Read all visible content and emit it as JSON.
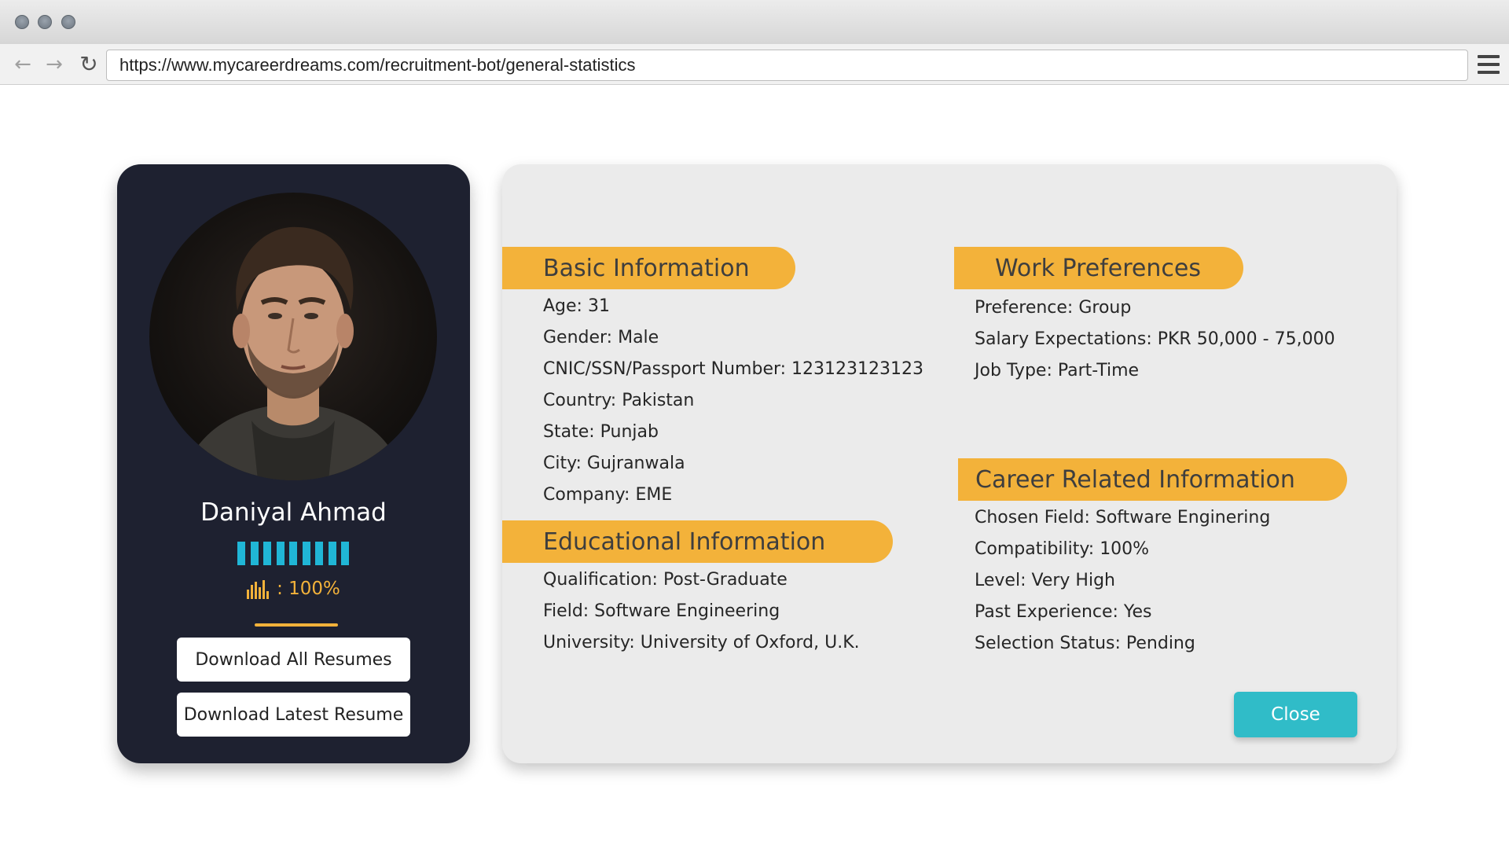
{
  "browser": {
    "url": "https://www.mycareerdreams.com/recruitment-bot/general-statistics"
  },
  "profile": {
    "name": "Daniyal Ahmad",
    "rating_level": 1.0,
    "compatibility_text": ": 100%",
    "download_all_label": "Download All Resumes",
    "download_latest_label": "Download Latest Resume"
  },
  "basic_info": {
    "title": "Basic Information",
    "fields": [
      "Age: 31",
      "Gender: Male",
      "CNIC/SSN/Passport Number: 123123123123",
      "Country: Pakistan",
      "State: Punjab",
      "City: Gujranwala",
      "Company: EME"
    ]
  },
  "educational_info": {
    "title": "Educational Information",
    "fields": [
      "Qualification: Post-Graduate",
      "Field: Software Engineering",
      "University: University of Oxford, U.K."
    ]
  },
  "work_preferences": {
    "title": "Work Preferences",
    "fields": [
      "Preference: Group",
      "Salary Expectations: PKR 50,000 - 75,000",
      "Job Type: Part-Time"
    ]
  },
  "career_info": {
    "title": "Career Related Information",
    "fields": [
      "Chosen Field: Software Enginering",
      "Compatibility: 100%",
      "Level: Very High",
      "Past Experience: Yes",
      "Selection Status: Pending"
    ]
  },
  "actions": {
    "close_label": "Close"
  },
  "colors": {
    "accent": "#f3b23a",
    "rating": "#20b6d6",
    "close_button": "#30bcc8",
    "card_background": "#1e2130"
  },
  "icons": {
    "back": "arrow-left-icon",
    "forward": "arrow-right-icon",
    "reload": "reload-icon",
    "menu": "hamburger-menu-icon",
    "compatibility": "bar-chart-icon"
  }
}
